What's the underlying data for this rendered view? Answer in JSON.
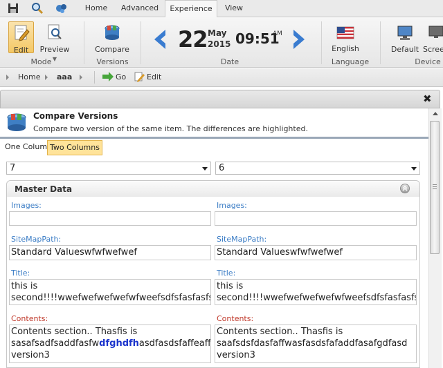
{
  "ribbon": {
    "tabs": [
      "Home",
      "Advanced",
      "Experience",
      "View"
    ],
    "mode_group": {
      "label": "Mode",
      "edit": "Edit",
      "preview": "Preview"
    },
    "versions_group": {
      "label": "Versions",
      "compare": "Compare"
    },
    "date_group": {
      "label": "Date",
      "day": "22",
      "month": "May",
      "year": "2015",
      "time": "09:51",
      "ampm": "AM"
    },
    "language_group": {
      "label": "Language",
      "english": "English"
    },
    "device_group": {
      "label": "Device",
      "default": "Default",
      "screen": "Scree"
    }
  },
  "breadcrumb": {
    "home": "Home",
    "item": "aaa",
    "go": "Go",
    "edit": "Edit"
  },
  "dialog": {
    "title": "Compare Versions",
    "description": "Compare two version of the same item. The differences are highlighted.",
    "close": "✖",
    "view_tabs": [
      "One Column",
      "Two Columns"
    ],
    "version_left": "7",
    "version_right": "6",
    "section_title": "Master Data"
  },
  "fields": {
    "left": {
      "images_label": "Images:",
      "sitemap_label": "SiteMapPath:",
      "sitemap_value": "Standard Valueswfwfwefwef",
      "title_label": "Title:",
      "title_line1": "this is",
      "title_line2": "second!!!!wwefwefwefwefwfweefsdfsfasfasfsa",
      "contents_label": "Contents:",
      "contents_line1": "Contents section.. Thasfis is",
      "contents_line2_a": "sasafsadfsaddfasfw",
      "contents_line2_hl": "dfghdfh",
      "contents_line2_b": "asdfasdsfaffeaffa",
      "contents_line3": "version3"
    },
    "right": {
      "images_label": "Images:",
      "sitemap_label": "SiteMapPath:",
      "sitemap_value": "Standard Valueswfwfwefwef",
      "title_label": "Title:",
      "title_line1": "this is",
      "title_line2": "second!!!!wwefwefwefwefwfweefsdfsfasfasfs",
      "contents_label": "Contents:",
      "contents_line1": "Contents section.. Thasfis is",
      "contents_line2": "saafsdsfdasfaffwasfasdsfafaddfasafgdfasd",
      "contents_line3": "version3"
    }
  },
  "colors": {
    "label_blue": "#3a7cc5",
    "label_red": "#c0392b",
    "highlight_blue": "#1a33cc",
    "selected_tab": "#ffe39a"
  }
}
